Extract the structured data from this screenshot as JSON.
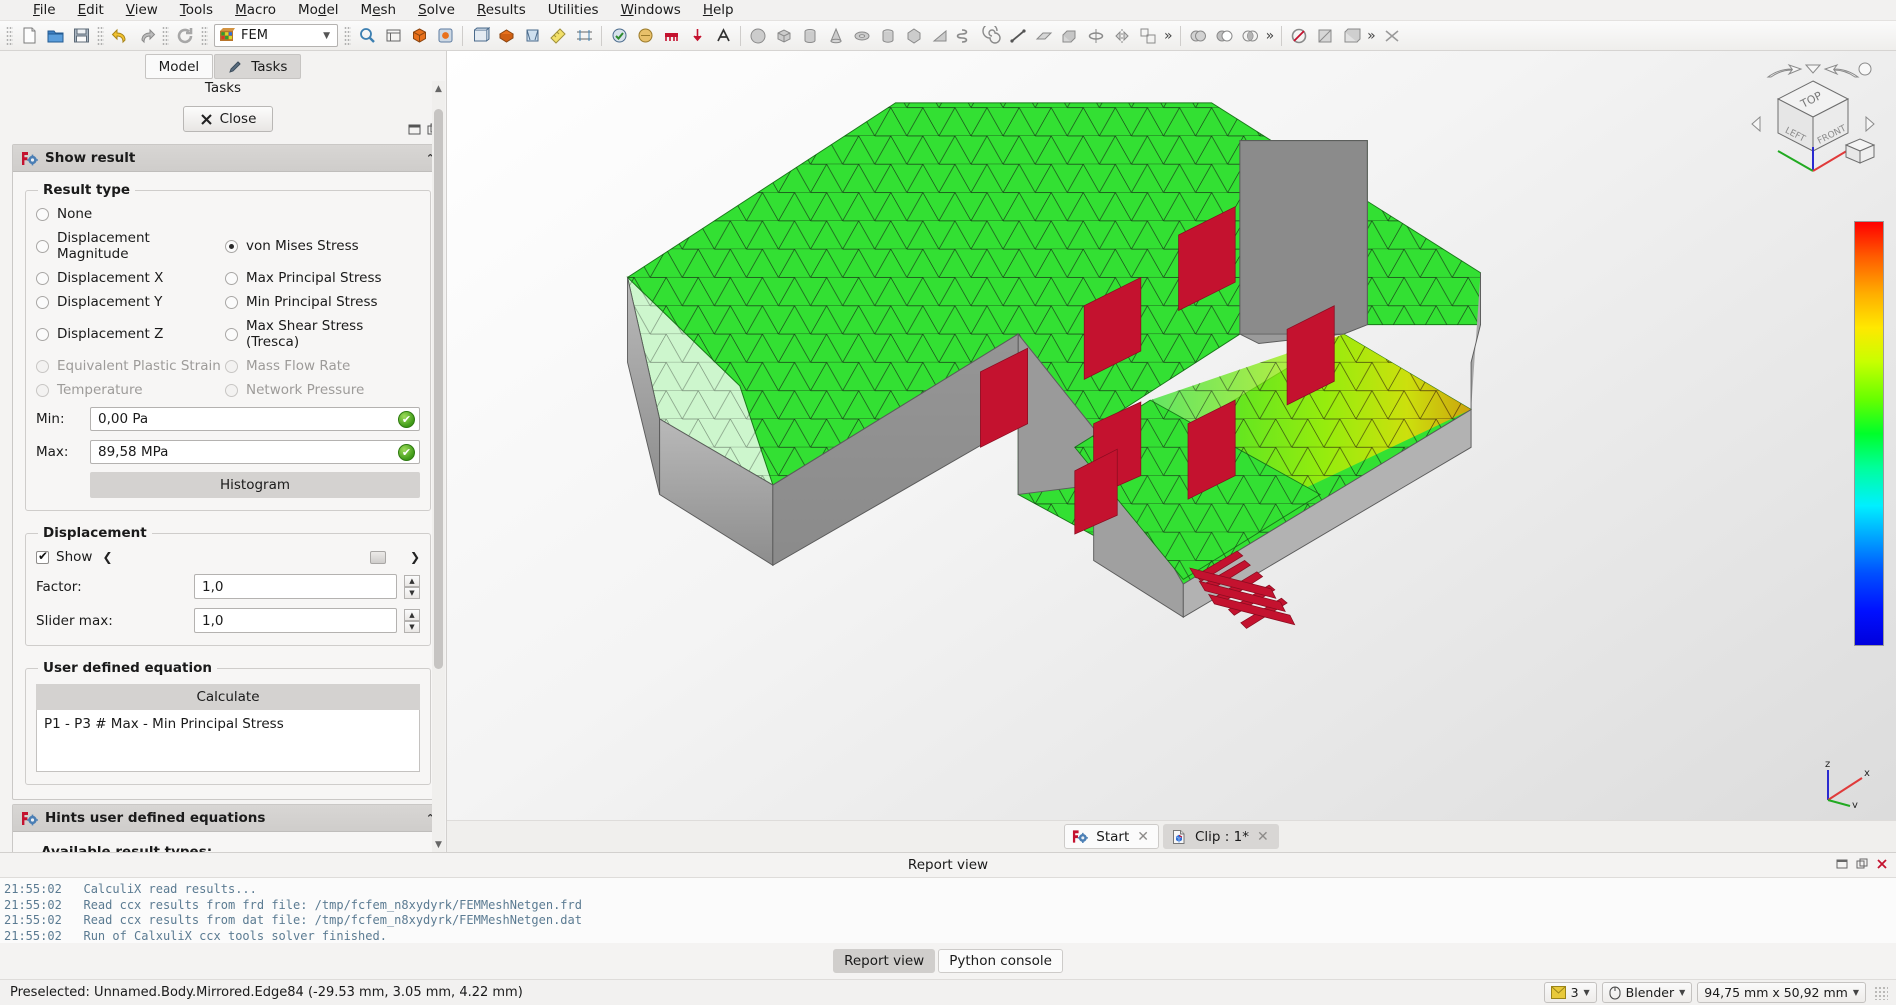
{
  "menubar": [
    {
      "pre": "",
      "accel": "F",
      "post": "ile"
    },
    {
      "pre": "",
      "accel": "E",
      "post": "dit"
    },
    {
      "pre": "",
      "accel": "V",
      "post": "iew"
    },
    {
      "pre": "",
      "accel": "T",
      "post": "ools"
    },
    {
      "pre": "",
      "accel": "M",
      "post": "acro"
    },
    {
      "pre": "Mo",
      "accel": "d",
      "post": "el"
    },
    {
      "pre": "M",
      "accel": "e",
      "post": "sh"
    },
    {
      "pre": "",
      "accel": "S",
      "post": "olve"
    },
    {
      "pre": "",
      "accel": "R",
      "post": "esults"
    },
    {
      "pre": "Utilities",
      "accel": "",
      "post": ""
    },
    {
      "pre": "",
      "accel": "W",
      "post": "indows"
    },
    {
      "pre": "",
      "accel": "H",
      "post": "elp"
    }
  ],
  "toolbar": {
    "workbench_label": "FEM",
    "workbench_icon": "fem-workbench-icon",
    "overflow_label": "»"
  },
  "combo_view": {
    "tab_model": "Model",
    "tab_tasks": "Tasks",
    "section_label": "Tasks",
    "close_label": "Close",
    "close_icon": "close-x-icon"
  },
  "show_result": {
    "title": "Show result",
    "icon": "fem-result-icon",
    "collapse_icon": "chevron-up-icon",
    "result_type": {
      "legend": "Result type",
      "left_column": [
        {
          "label": "None",
          "checked": false,
          "disabled": false
        },
        {
          "label": "Displacement Magnitude",
          "checked": false,
          "disabled": false
        },
        {
          "label": "Displacement X",
          "checked": false,
          "disabled": false
        },
        {
          "label": "Displacement Y",
          "checked": false,
          "disabled": false
        },
        {
          "label": "Displacement Z",
          "checked": false,
          "disabled": false
        },
        {
          "label": "Equivalent Plastic Strain",
          "checked": false,
          "disabled": true
        },
        {
          "label": "Temperature",
          "checked": false,
          "disabled": true
        }
      ],
      "right_column": [
        {
          "label": "von Mises Stress",
          "checked": true,
          "disabled": false
        },
        {
          "label": "Max Principal Stress",
          "checked": false,
          "disabled": false
        },
        {
          "label": "Min Principal Stress",
          "checked": false,
          "disabled": false
        },
        {
          "label": "Max Shear Stress (Tresca)",
          "checked": false,
          "disabled": false
        },
        {
          "label": "Mass Flow Rate",
          "checked": false,
          "disabled": true
        },
        {
          "label": "Network Pressure",
          "checked": false,
          "disabled": true
        }
      ],
      "min_label": "Min:",
      "min_value": "0,00 Pa",
      "max_label": "Max:",
      "max_value": "89,58 MPa",
      "valid_icon": "green-check-icon",
      "histogram_label": "Histogram"
    },
    "displacement": {
      "legend": "Displacement",
      "show_label": "Show",
      "show_checked": true,
      "collapse_icon": "chevron-left-icon",
      "expand_icon": "chevron-right-icon",
      "factor_label": "Factor:",
      "factor_value": "1,0",
      "slider_max_label": "Slider max:",
      "slider_max_value": "1,0"
    },
    "user_equation": {
      "legend": "User defined equation",
      "calculate_label": "Calculate",
      "equation_text": "P1 - P3 # Max - Min Principal Stress"
    }
  },
  "hints": {
    "title": "Hints user defined equations",
    "icon": "fem-result-icon",
    "collapse_icon": "chevron-up-icon",
    "available_label": "Available result types:"
  },
  "mdi_tabs": [
    {
      "label": "Start",
      "icon": "freecad-start-icon",
      "active": false,
      "close_icon": "close-x-icon"
    },
    {
      "label": "Clip : 1*",
      "icon": "document-icon",
      "active": true,
      "close_icon": "close-x-icon"
    }
  ],
  "report": {
    "title": "Report view",
    "float_icon": "undock-icon",
    "restore_icon": "restore-icon",
    "close_icon": "close-x-icon",
    "lines": [
      {
        "time": "21:55:02",
        "text": "CalculiX read results..."
      },
      {
        "time": "21:55:02",
        "text": "Read ccx results from frd file: /tmp/fcfem_n8xydyrk/FEMMeshNetgen.frd"
      },
      {
        "time": "21:55:02",
        "text": "Read ccx results from dat file: /tmp/fcfem_n8xydyrk/FEMMeshNetgen.dat"
      },
      {
        "time": "21:55:02",
        "text": "Run of CalxuliX ccx tools solver finished."
      }
    ],
    "tabs": [
      {
        "label": "Report view",
        "active": true
      },
      {
        "label": "Python console",
        "active": false
      }
    ]
  },
  "statusbar": {
    "message": "Preselected: Unnamed.Body.Mirrored.Edge84 (-29.53 mm, 3.05 mm, 4.22 mm)",
    "chips": [
      {
        "icon": "layer-swatch-icon",
        "label": "3",
        "caret": "▾"
      },
      {
        "icon": "mouse-icon",
        "label": "Blender",
        "caret": "▾"
      },
      {
        "icon": "",
        "label": "94,75 mm x 50,92 mm",
        "caret": "▾"
      }
    ]
  },
  "view3d": {
    "navcube_top": "TOP",
    "navcube_front": "FRONT",
    "navcube_left": "LEFT",
    "axis_x": "x",
    "axis_y": "y",
    "axis_z": "z",
    "colorbar_name": "result-color-bar"
  },
  "colors": {
    "mesh_green": "#33e033",
    "mesh_yellow": "#e8e800",
    "constraint_red": "#c4122f",
    "gray_face": "#9a9a9a",
    "accent_blue": "#3c7fb1"
  }
}
